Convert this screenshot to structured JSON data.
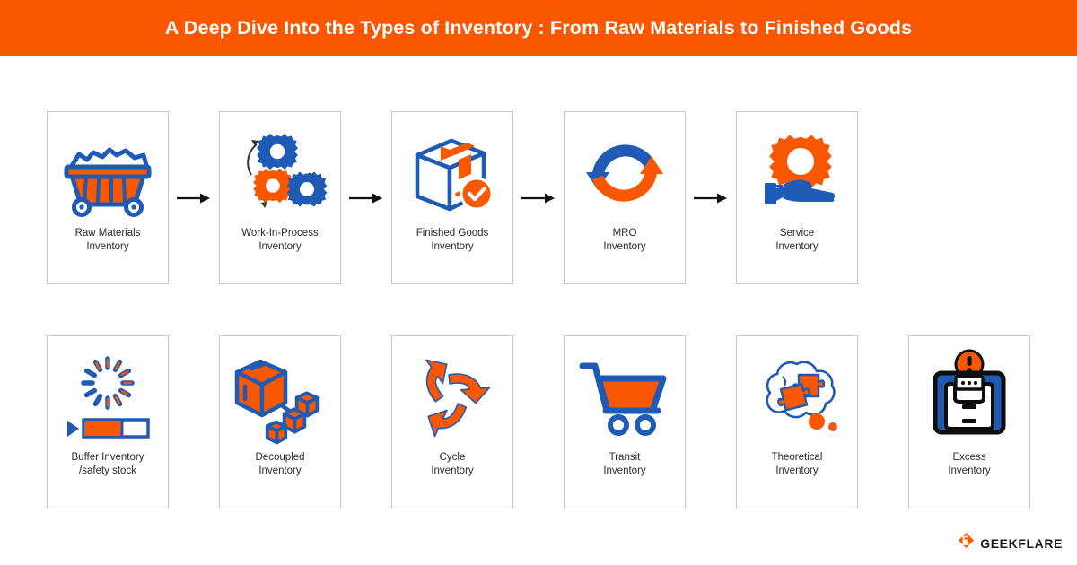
{
  "header": {
    "title": "A Deep Dive Into the Types of Inventory : From Raw Materials to Finished Goods",
    "background": "#f95700",
    "text_color": "#ffffff"
  },
  "palette": {
    "orange": "#f95700",
    "blue": "#1f5bb5",
    "card_border": "#c9c9c9",
    "label": "#2b2b2b",
    "arrow": "#111111"
  },
  "rows": [
    {
      "connector": "arrow-right",
      "cards": [
        {
          "icon": "raw-materials-cart-icon",
          "line1": "Raw Materials",
          "line2": "Inventory"
        },
        {
          "icon": "gears-process-icon",
          "line1": "Work-In-Process",
          "line2": "Inventory"
        },
        {
          "icon": "finished-goods-box-check-icon",
          "line1": "Finished Goods",
          "line2": "Inventory"
        },
        {
          "icon": "mro-refresh-cycle-icon",
          "line1": "MRO",
          "line2": "Inventory"
        },
        {
          "icon": "service-hand-gear-icon",
          "line1": "Service",
          "line2": "Inventory"
        }
      ]
    },
    {
      "connector": "none",
      "cards": [
        {
          "icon": "buffer-spinner-progress-icon",
          "line1": "Buffer Inventory",
          "line2": "/safety stock"
        },
        {
          "icon": "decoupled-boxes-icon",
          "line1": "Decoupled",
          "line2": "Inventory"
        },
        {
          "icon": "cycle-arrows-icon",
          "line1": "Cycle",
          "line2": "Inventory"
        },
        {
          "icon": "transit-cart-icon",
          "line1": "Transit",
          "line2": "Inventory"
        },
        {
          "icon": "theoretical-thought-puzzle-icon",
          "line1": "Theoretical",
          "line2": "Inventory"
        },
        {
          "icon": "excess-overfilled-bin-icon",
          "line1": "Excess",
          "line2": "Inventory"
        }
      ]
    }
  ],
  "footer": {
    "logo_mark": "geekflare-flame-icon",
    "logo_text": "GEEKFLARE"
  }
}
